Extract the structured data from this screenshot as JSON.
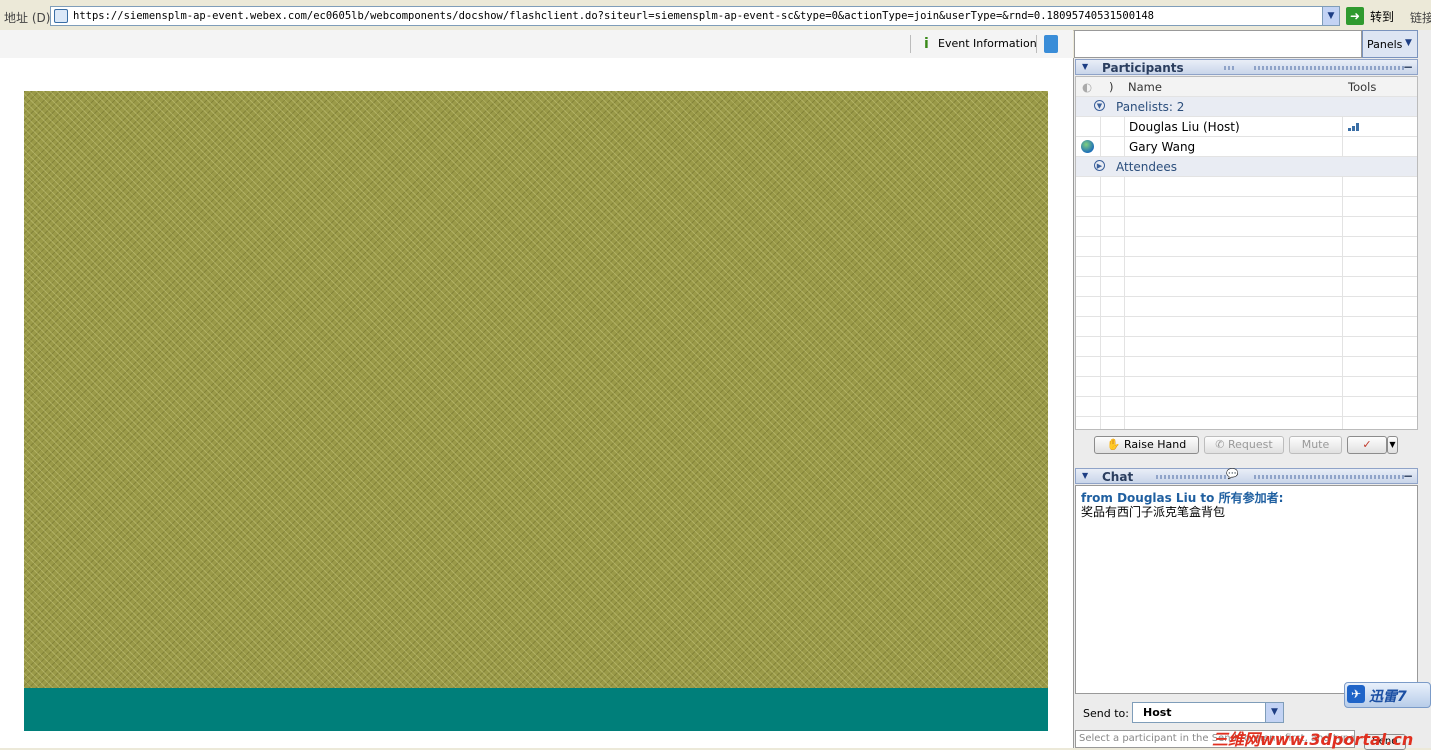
{
  "address_bar": {
    "label": "地址 (D)",
    "url": "https://siemensplm-ap-event.webex.com/ec0605lb/webcomponents/docshow/flashclient.do?siteurl=siemensplm-ap-event-sc&type=0&actionType=join&userType=&rnd=0.18095740531500148",
    "go_label": "转到",
    "links_label": "链接"
  },
  "toolbar": {
    "event_info_label": "Event Information"
  },
  "colors": {
    "slide_pattern": "#9a9a48",
    "slide_footer": "#007f7a",
    "chat_from": "#1f5fa0"
  },
  "panels": {
    "button_label": "Panels"
  },
  "participants": {
    "title": "Participants",
    "columns": {
      "name": "Name",
      "tools": "Tools"
    },
    "panelists_label": "Panelists: 2",
    "panelists": [
      {
        "name": "Douglas Liu (Host)",
        "tool_icon": "signal-bars-icon"
      },
      {
        "name": "Gary Wang",
        "status_icon": "globe-icon"
      }
    ],
    "attendees_label": "Attendees"
  },
  "actions": {
    "raise_hand": "Raise Hand",
    "request": "Request",
    "mute": "Mute"
  },
  "chat": {
    "title": "Chat",
    "from_line": "from Douglas Liu to 所有参加者:",
    "message": "奖品有西门子派克笔盒背包",
    "send_to_label": "Send to:",
    "send_to_value": "Host",
    "input_placeholder": "Select a participant in the Send to menu first, and type",
    "send_label": "Send"
  },
  "overlays": {
    "xunlei_label": "迅雷7",
    "watermark": "三维网www.3dportal.cn"
  }
}
